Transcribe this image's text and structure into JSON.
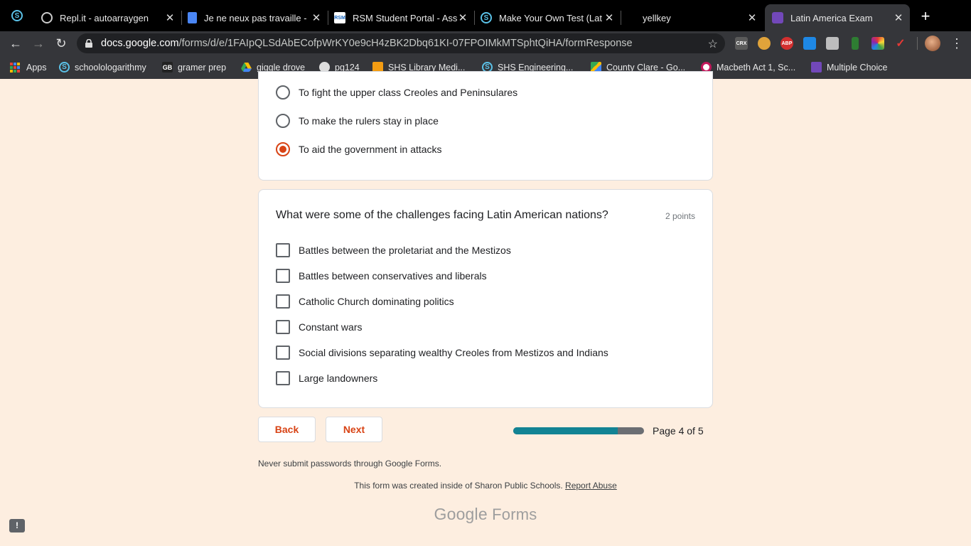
{
  "browser": {
    "tabs": [
      {
        "title": "Repl.it - autoarraygen",
        "icon": "replit-icon"
      },
      {
        "title": "Je ne neux pas travaille -",
        "icon": "google-docs-icon"
      },
      {
        "title": "RSM Student Portal - Ass",
        "icon": "rsm-icon"
      },
      {
        "title": "Make Your Own Test (Lat",
        "icon": "schoology-icon"
      },
      {
        "title": "yellkey",
        "icon": ""
      },
      {
        "title": "Latin America Exam",
        "icon": "google-forms-icon"
      }
    ],
    "url_host": "docs.google.com",
    "url_path": "/forms/d/e/1FAIpQLSdAbECofpWrKY0e9cH4zBK2Dbq61KI-07FPOIMkMTSphtQiHA/formResponse",
    "close_glyph": "✕",
    "new_tab_glyph": "+",
    "back_glyph": "←",
    "forward_glyph": "→",
    "reload_glyph": "↻",
    "star_glyph": "☆",
    "menu_glyph": "⋮",
    "extensions": [
      {
        "name": "crx-icon",
        "label": "CRX",
        "color": "#5a5a5a"
      },
      {
        "name": "owl-icon",
        "label": "",
        "color": "#e0a33a"
      },
      {
        "name": "adblock-icon",
        "label": "ABP",
        "color": "#d32f2f"
      },
      {
        "name": "tick-icon",
        "label": "",
        "color": "#1e88e5"
      },
      {
        "name": "briefcase-icon",
        "label": "",
        "color": "#bdbdbd"
      },
      {
        "name": "leaf-icon",
        "label": "",
        "color": "#2e7d32"
      },
      {
        "name": "colorful-icon",
        "label": "",
        "color": "#8e24aa"
      },
      {
        "name": "tool-icon",
        "label": "",
        "color": "#e53935"
      }
    ]
  },
  "bookmarks": [
    {
      "label": "Apps",
      "icon": "apps-grid-icon"
    },
    {
      "label": "schoolologarithmy",
      "icon": "schoology-icon"
    },
    {
      "label": "gramer prep",
      "icon": "gb-icon"
    },
    {
      "label": "giggle drove",
      "icon": "google-drive-icon"
    },
    {
      "label": "pg124",
      "icon": "globe-icon"
    },
    {
      "label": "SHS Library Medi...",
      "icon": "library-icon"
    },
    {
      "label": "SHS Engineering...",
      "icon": "schoology-icon"
    },
    {
      "label": "County Clare - Go...",
      "icon": "maps-icon"
    },
    {
      "label": "Macbeth Act 1, Sc...",
      "icon": "macbeth-icon"
    },
    {
      "label": "Multiple Choice",
      "icon": "google-forms-icon"
    }
  ],
  "question1": {
    "options": [
      {
        "label": "To fight the upper class Creoles and Peninsulares",
        "checked": false
      },
      {
        "label": "To make the rulers stay in place",
        "checked": false
      },
      {
        "label": "To aid the government in attacks",
        "checked": true
      }
    ]
  },
  "question2": {
    "title": "What were some of the challenges facing Latin American nations?",
    "points": "2 points",
    "options": [
      {
        "label": "Battles between the proletariat and the Mestizos",
        "checked": false
      },
      {
        "label": "Battles between conservatives and liberals",
        "checked": false
      },
      {
        "label": "Catholic Church dominating politics",
        "checked": false
      },
      {
        "label": "Constant wars",
        "checked": false
      },
      {
        "label": "Social divisions separating wealthy Creoles from Mestizos and Indians",
        "checked": false
      },
      {
        "label": "Large landowners",
        "checked": false
      }
    ]
  },
  "nav": {
    "back_label": "Back",
    "next_label": "Next",
    "progress": 0.8,
    "page_label": "Page 4 of 5"
  },
  "footer": {
    "warning": "Never submit passwords through Google Forms.",
    "created": "This form was created inside of Sharon Public Schools.",
    "report": "Report Abuse",
    "brand_google": "Google",
    "brand_forms": "Forms",
    "feedback_glyph": "!"
  },
  "colors": {
    "accent": "#d84315",
    "progress_fill": "#128394",
    "background": "#fdeee0"
  }
}
